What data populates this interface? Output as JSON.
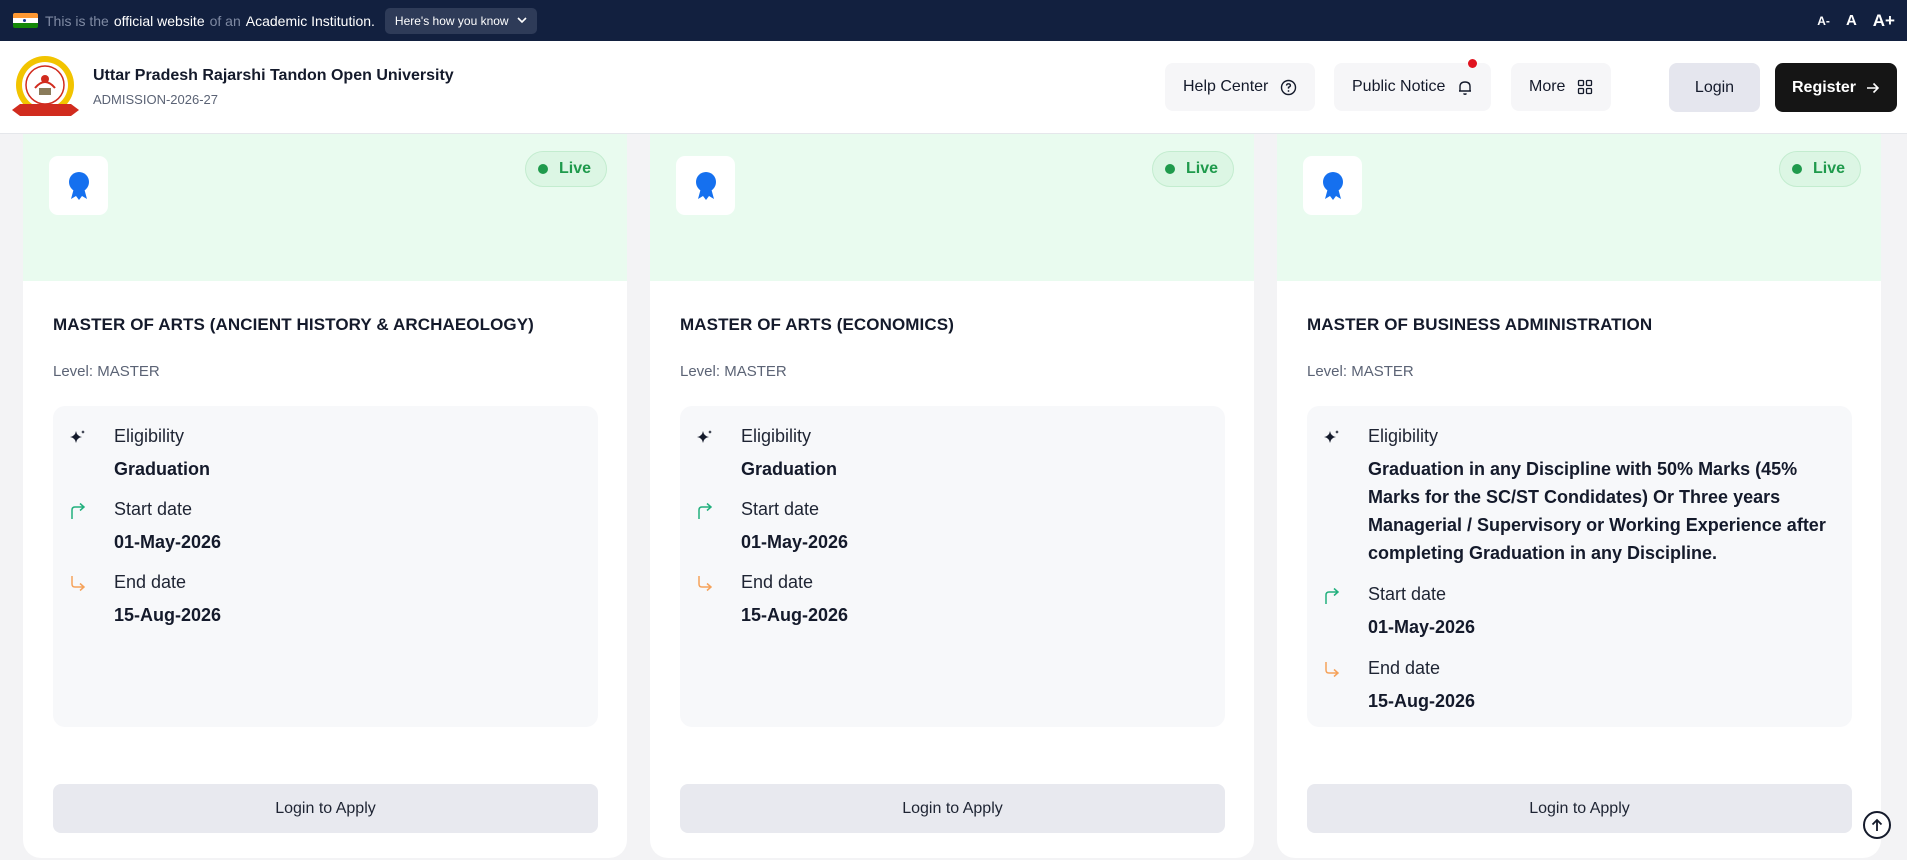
{
  "gov_banner": {
    "text_prefix": "This is the",
    "text_highlight1": "official website",
    "text_mid": "of an",
    "text_highlight2": "Academic Institution.",
    "know_button": "Here's how you know",
    "font_decrease": "A-",
    "font_normal": "A",
    "font_increase": "A+"
  },
  "header": {
    "title": "Uttar Pradesh Rajarshi Tandon Open University",
    "subtitle": "ADMISSION-2026-27",
    "help_center": "Help Center",
    "public_notice": "Public Notice",
    "more": "More",
    "login": "Login",
    "register": "Register"
  },
  "colors": {
    "live_green": "#1f9a4c",
    "card_top_bg": "#e9fbef",
    "badge_blue": "#1570ef",
    "start_icon": "#22b07d",
    "end_icon": "#f5a25a"
  },
  "cards": [
    {
      "status": "Live",
      "title": "MASTER OF ARTS (ANCIENT HISTORY & ARCHAEOLOGY)",
      "level": "Level: MASTER",
      "eligibility_label": "Eligibility",
      "eligibility": "Graduation",
      "start_label": "Start date",
      "start_date": "01-May-2026",
      "end_label": "End date",
      "end_date": "15-Aug-2026",
      "apply": "Login to Apply"
    },
    {
      "status": "Live",
      "title": "MASTER OF ARTS (ECONOMICS)",
      "level": "Level: MASTER",
      "eligibility_label": "Eligibility",
      "eligibility": "Graduation",
      "start_label": "Start date",
      "start_date": "01-May-2026",
      "end_label": "End date",
      "end_date": "15-Aug-2026",
      "apply": "Login to Apply"
    },
    {
      "status": "Live",
      "title": "MASTER OF BUSINESS ADMINISTRATION",
      "level": "Level: MASTER",
      "eligibility_label": "Eligibility",
      "eligibility": "Graduation in any Discipline with 50% Marks (45% Marks for the SC/ST Condidates) Or Three years Managerial / Supervisory or Working Experience after completing Graduation in any Discipline.",
      "start_label": "Start date",
      "start_date": "01-May-2026",
      "end_label": "End date",
      "end_date": "15-Aug-2026",
      "apply": "Login to Apply"
    }
  ]
}
